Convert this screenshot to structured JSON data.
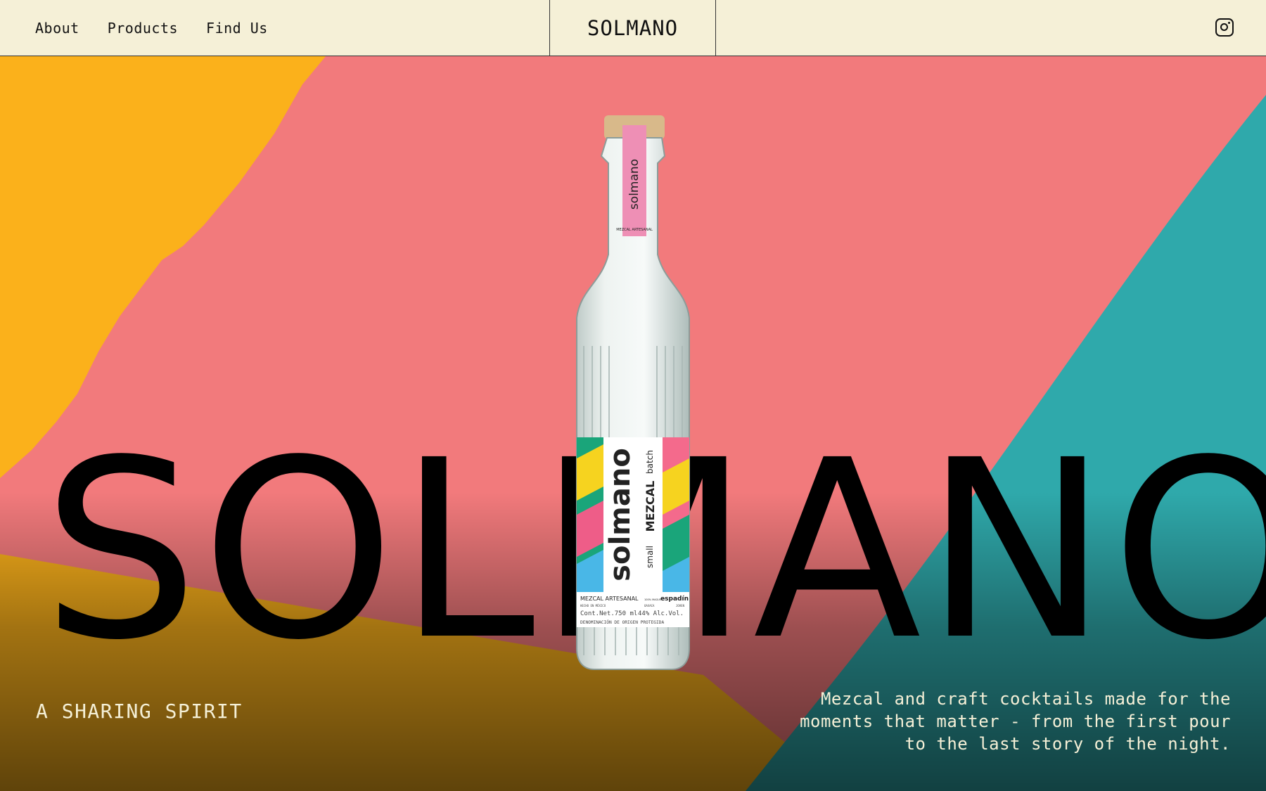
{
  "header": {
    "nav": [
      {
        "label": "About"
      },
      {
        "label": "Products"
      },
      {
        "label": "Find Us"
      }
    ],
    "brand": "SOLMANO",
    "social_icon": "instagram-icon"
  },
  "hero": {
    "big_word": "SOLMANO",
    "tagline": "A SHARING SPIRIT",
    "description": "Mezcal and craft cocktails made for the moments that matter - from the first pour to the last story of the night.",
    "bottle_label": {
      "neck_brand": "solmano",
      "neck_sub": "MEZCAL ARTESANAL",
      "brand": "solmano",
      "small": "small",
      "mezcal": "MEZCAL",
      "batch": "batch",
      "type": "MEZCAL ARTESANAL",
      "agave": "espadín",
      "origin": "HECHO EN MÉXICO",
      "region": "OAXACA",
      "age": "JOVEN",
      "agave_note": "100% MAGUEY",
      "content": "Cont.Net.750 ml",
      "abv": "44% Alc.Vol.",
      "denomination": "DENOMINACIÓN DE ORIGEN PROTEGIDA"
    },
    "colors": {
      "cream": "#f5f0d7",
      "coral": "#f27a7c",
      "yellow": "#fbb11b",
      "teal": "#2fa9ab"
    }
  }
}
